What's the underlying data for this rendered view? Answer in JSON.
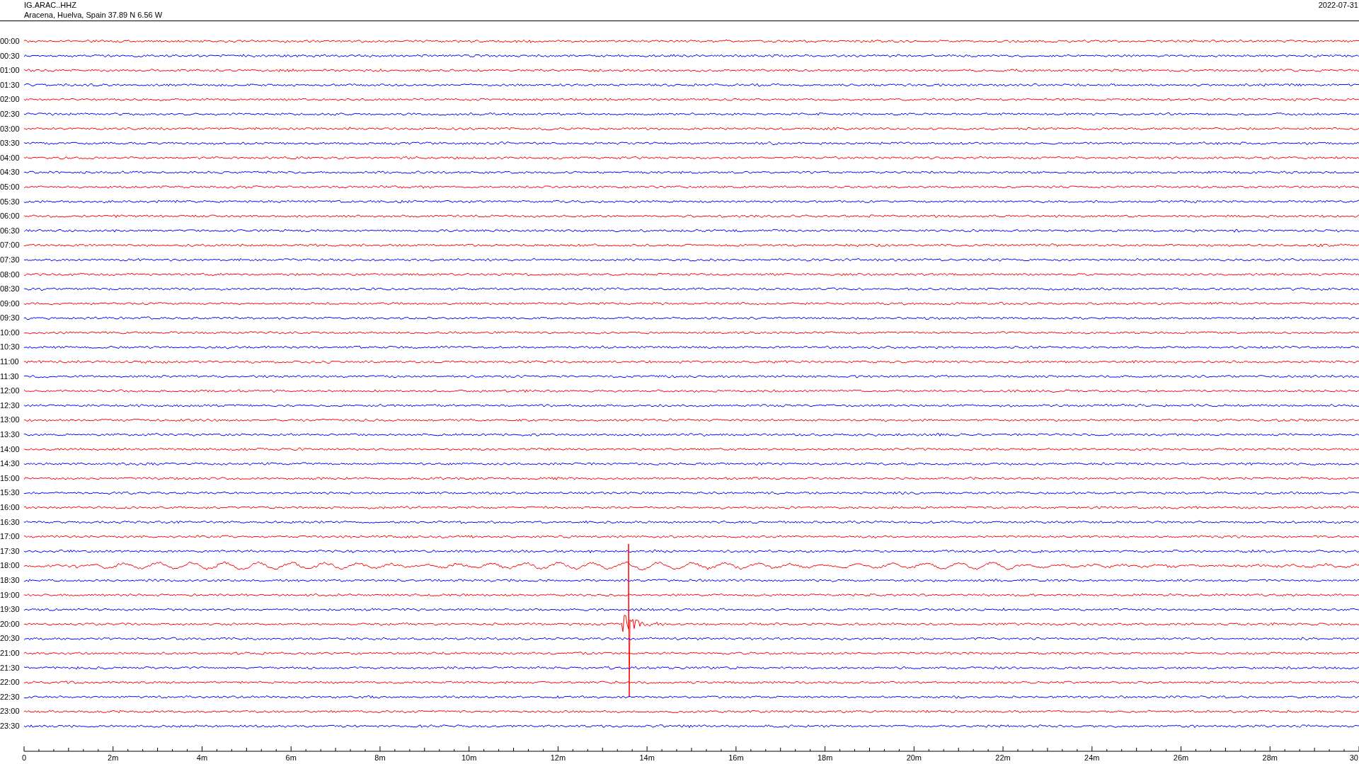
{
  "header": {
    "station": "IG.ARAC..HHZ",
    "location": "Aracena, Huelva, Spain  37.89 N 6.56 W",
    "date": "2022-07-31"
  },
  "rows": [
    {
      "label": "00:00",
      "color": "#ff0000"
    },
    {
      "label": "00:30",
      "color": "#0000ff"
    },
    {
      "label": "01:00",
      "color": "#ff0000"
    },
    {
      "label": "01:30",
      "color": "#0000ff"
    },
    {
      "label": "02:00",
      "color": "#ff0000"
    },
    {
      "label": "02:30",
      "color": "#0000ff"
    },
    {
      "label": "03:00",
      "color": "#ff0000"
    },
    {
      "label": "03:30",
      "color": "#0000ff"
    },
    {
      "label": "04:00",
      "color": "#ff0000"
    },
    {
      "label": "04:30",
      "color": "#0000ff"
    },
    {
      "label": "05:00",
      "color": "#ff0000"
    },
    {
      "label": "05:30",
      "color": "#0000ff"
    },
    {
      "label": "06:00",
      "color": "#ff0000"
    },
    {
      "label": "06:30",
      "color": "#0000ff"
    },
    {
      "label": "07:00",
      "color": "#ff0000"
    },
    {
      "label": "07:30",
      "color": "#0000ff"
    },
    {
      "label": "08:00",
      "color": "#ff0000"
    },
    {
      "label": "08:30",
      "color": "#0000ff"
    },
    {
      "label": "09:00",
      "color": "#ff0000"
    },
    {
      "label": "09:30",
      "color": "#0000ff"
    },
    {
      "label": "10:00",
      "color": "#ff0000"
    },
    {
      "label": "10:30",
      "color": "#0000ff"
    },
    {
      "label": "11:00",
      "color": "#ff0000"
    },
    {
      "label": "11:30",
      "color": "#0000ff"
    },
    {
      "label": "12:00",
      "color": "#ff0000"
    },
    {
      "label": "12:30",
      "color": "#0000ff"
    },
    {
      "label": "13:00",
      "color": "#ff0000"
    },
    {
      "label": "13:30",
      "color": "#0000ff"
    },
    {
      "label": "14:00",
      "color": "#ff0000"
    },
    {
      "label": "14:30",
      "color": "#0000ff"
    },
    {
      "label": "15:00",
      "color": "#ff0000"
    },
    {
      "label": "15:30",
      "color": "#0000ff"
    },
    {
      "label": "16:00",
      "color": "#ff0000"
    },
    {
      "label": "16:30",
      "color": "#0000ff"
    },
    {
      "label": "17:00",
      "color": "#ff0000"
    },
    {
      "label": "17:30",
      "color": "#0000ff"
    },
    {
      "label": "18:00",
      "color": "#ff0000"
    },
    {
      "label": "18:30",
      "color": "#0000ff"
    },
    {
      "label": "19:00",
      "color": "#ff0000"
    },
    {
      "label": "19:30",
      "color": "#0000ff"
    },
    {
      "label": "20:00",
      "color": "#ff0000"
    },
    {
      "label": "20:30",
      "color": "#0000ff"
    },
    {
      "label": "21:00",
      "color": "#ff0000"
    },
    {
      "label": "21:30",
      "color": "#0000ff"
    },
    {
      "label": "22:00",
      "color": "#ff0000"
    },
    {
      "label": "22:30",
      "color": "#0000ff"
    },
    {
      "label": "23:00",
      "color": "#ff0000"
    },
    {
      "label": "23:30",
      "color": "#0000ff"
    }
  ],
  "x_axis": {
    "ticks": [
      "0",
      "2m",
      "4m",
      "6m",
      "8m",
      "10m",
      "12m",
      "14m",
      "16m",
      "18m",
      "20m",
      "22m",
      "24m",
      "26m",
      "28m",
      "30"
    ]
  }
}
